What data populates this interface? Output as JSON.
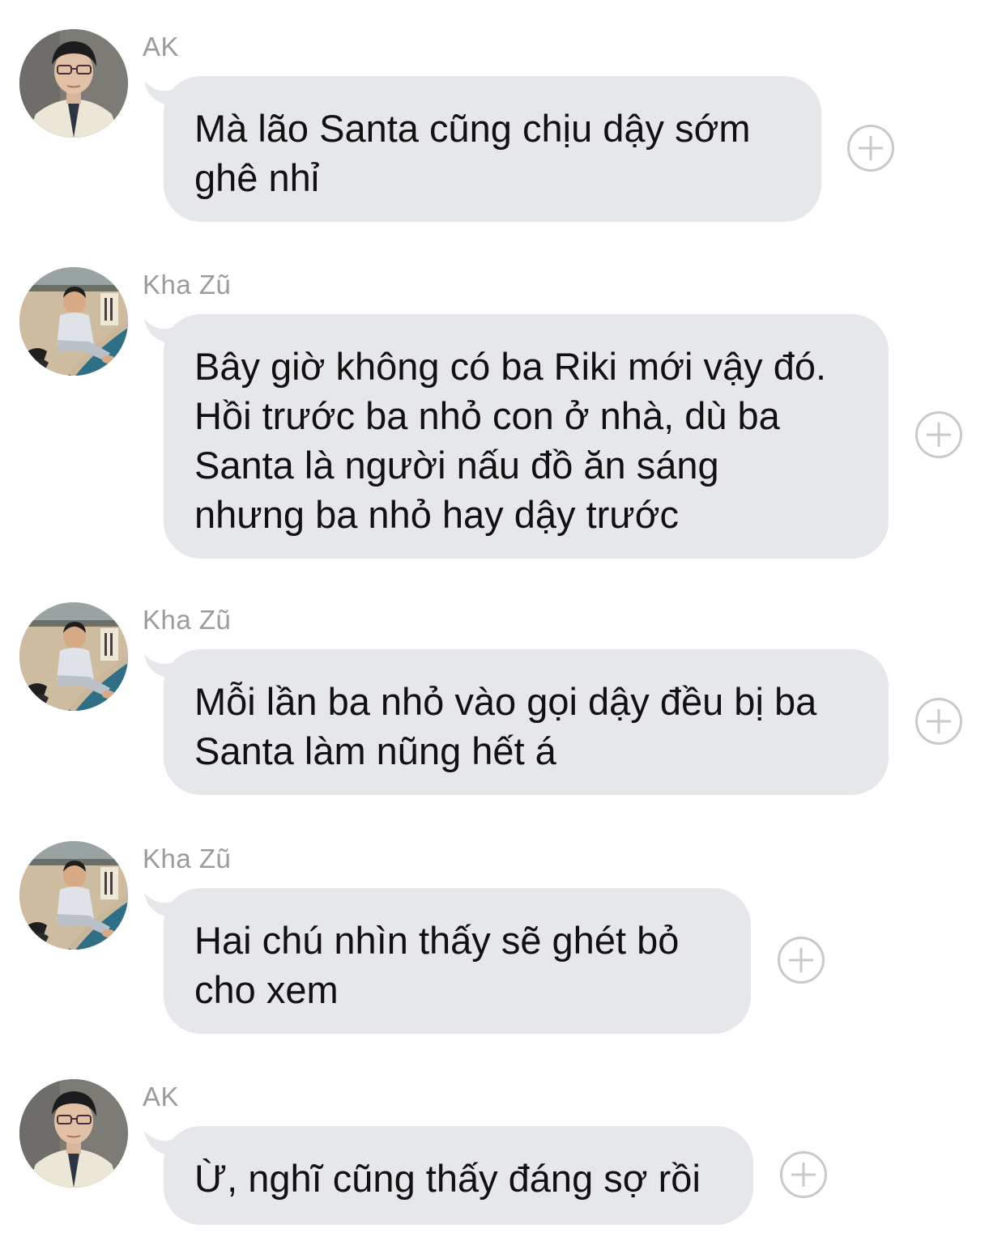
{
  "messages": [
    {
      "sender": "AK",
      "avatar": "ak-avatar",
      "text": "Mà lão Santa cũng chịu dậy sớm\nghê nhỉ"
    },
    {
      "sender": "Kha Zũ",
      "avatar": "kha-zu-avatar",
      "text": "Bây giờ không có ba Riki mới vậy đó.\nHồi trước ba nhỏ con ở nhà, dù ba\nSanta là người nấu đồ ăn sáng\nnhưng ba nhỏ hay dậy trước"
    },
    {
      "sender": "Kha Zũ",
      "avatar": "kha-zu-avatar",
      "text": "Mỗi lần ba nhỏ vào gọi dậy đều bị ba\nSanta làm nũng hết á"
    },
    {
      "sender": "Kha Zũ",
      "avatar": "kha-zu-avatar",
      "text": "Hai chú nhìn thấy sẽ ghét bỏ\ncho xem"
    },
    {
      "sender": "AK",
      "avatar": "ak-avatar",
      "text": "Ừ, nghĩ cũng thấy đáng sợ rồi"
    }
  ],
  "colors": {
    "bubble": "#e5e7ea",
    "sender_text": "#9b9b9b",
    "message_text": "#111111",
    "add_icon": "#c9c9c9"
  },
  "icons": {
    "add_reaction": "plus-circle-icon"
  }
}
